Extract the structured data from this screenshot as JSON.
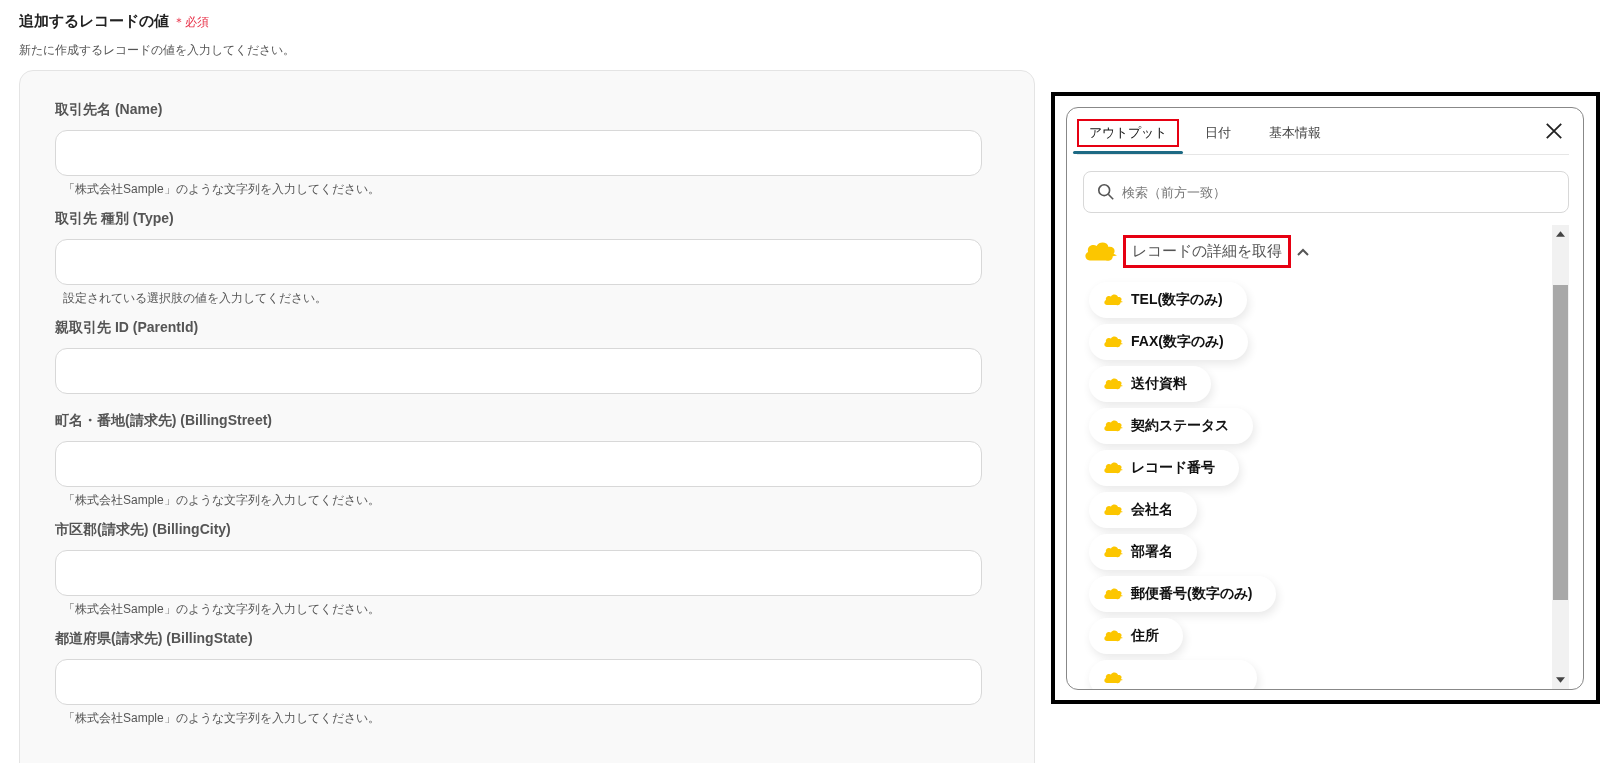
{
  "form": {
    "title": "追加するレコードの値",
    "required_mark": "＊必須",
    "description": "新たに作成するレコードの値を入力してください。",
    "fields": [
      {
        "label": "取引先名 (Name)",
        "hint": "「株式会社Sample」のような文字列を入力してください。"
      },
      {
        "label": "取引先 種別 (Type)",
        "hint": "設定されている選択肢の値を入力してください。"
      },
      {
        "label": "親取引先 ID (ParentId)"
      },
      {
        "label": "町名・番地(請求先) (BillingStreet)",
        "hint": "「株式会社Sample」のような文字列を入力してください。"
      },
      {
        "label": "市区郡(請求先) (BillingCity)",
        "hint": "「株式会社Sample」のような文字列を入力してください。"
      },
      {
        "label": "都道府県(請求先) (BillingState)",
        "hint": "「株式会社Sample」のような文字列を入力してください。"
      }
    ]
  },
  "panel": {
    "tabs": [
      {
        "label": "アウトプット",
        "selected": true,
        "highlighted": true
      },
      {
        "label": "日付",
        "selected": false,
        "highlighted": false
      },
      {
        "label": "基本情報",
        "selected": false,
        "highlighted": false
      }
    ],
    "search": {
      "placeholder": "検索（前方一致）"
    },
    "section": {
      "title": "レコードの詳細を取得",
      "expanded": true,
      "highlighted": true
    },
    "items": [
      {
        "label": "TEL(数字のみ)"
      },
      {
        "label": "FAX(数字のみ)"
      },
      {
        "label": "送付資料"
      },
      {
        "label": "契約ステータス"
      },
      {
        "label": "レコード番号"
      },
      {
        "label": "会社名"
      },
      {
        "label": "部署名"
      },
      {
        "label": "郵便番号(数字のみ)"
      },
      {
        "label": "住所"
      },
      {
        "kind": "cut"
      }
    ]
  }
}
